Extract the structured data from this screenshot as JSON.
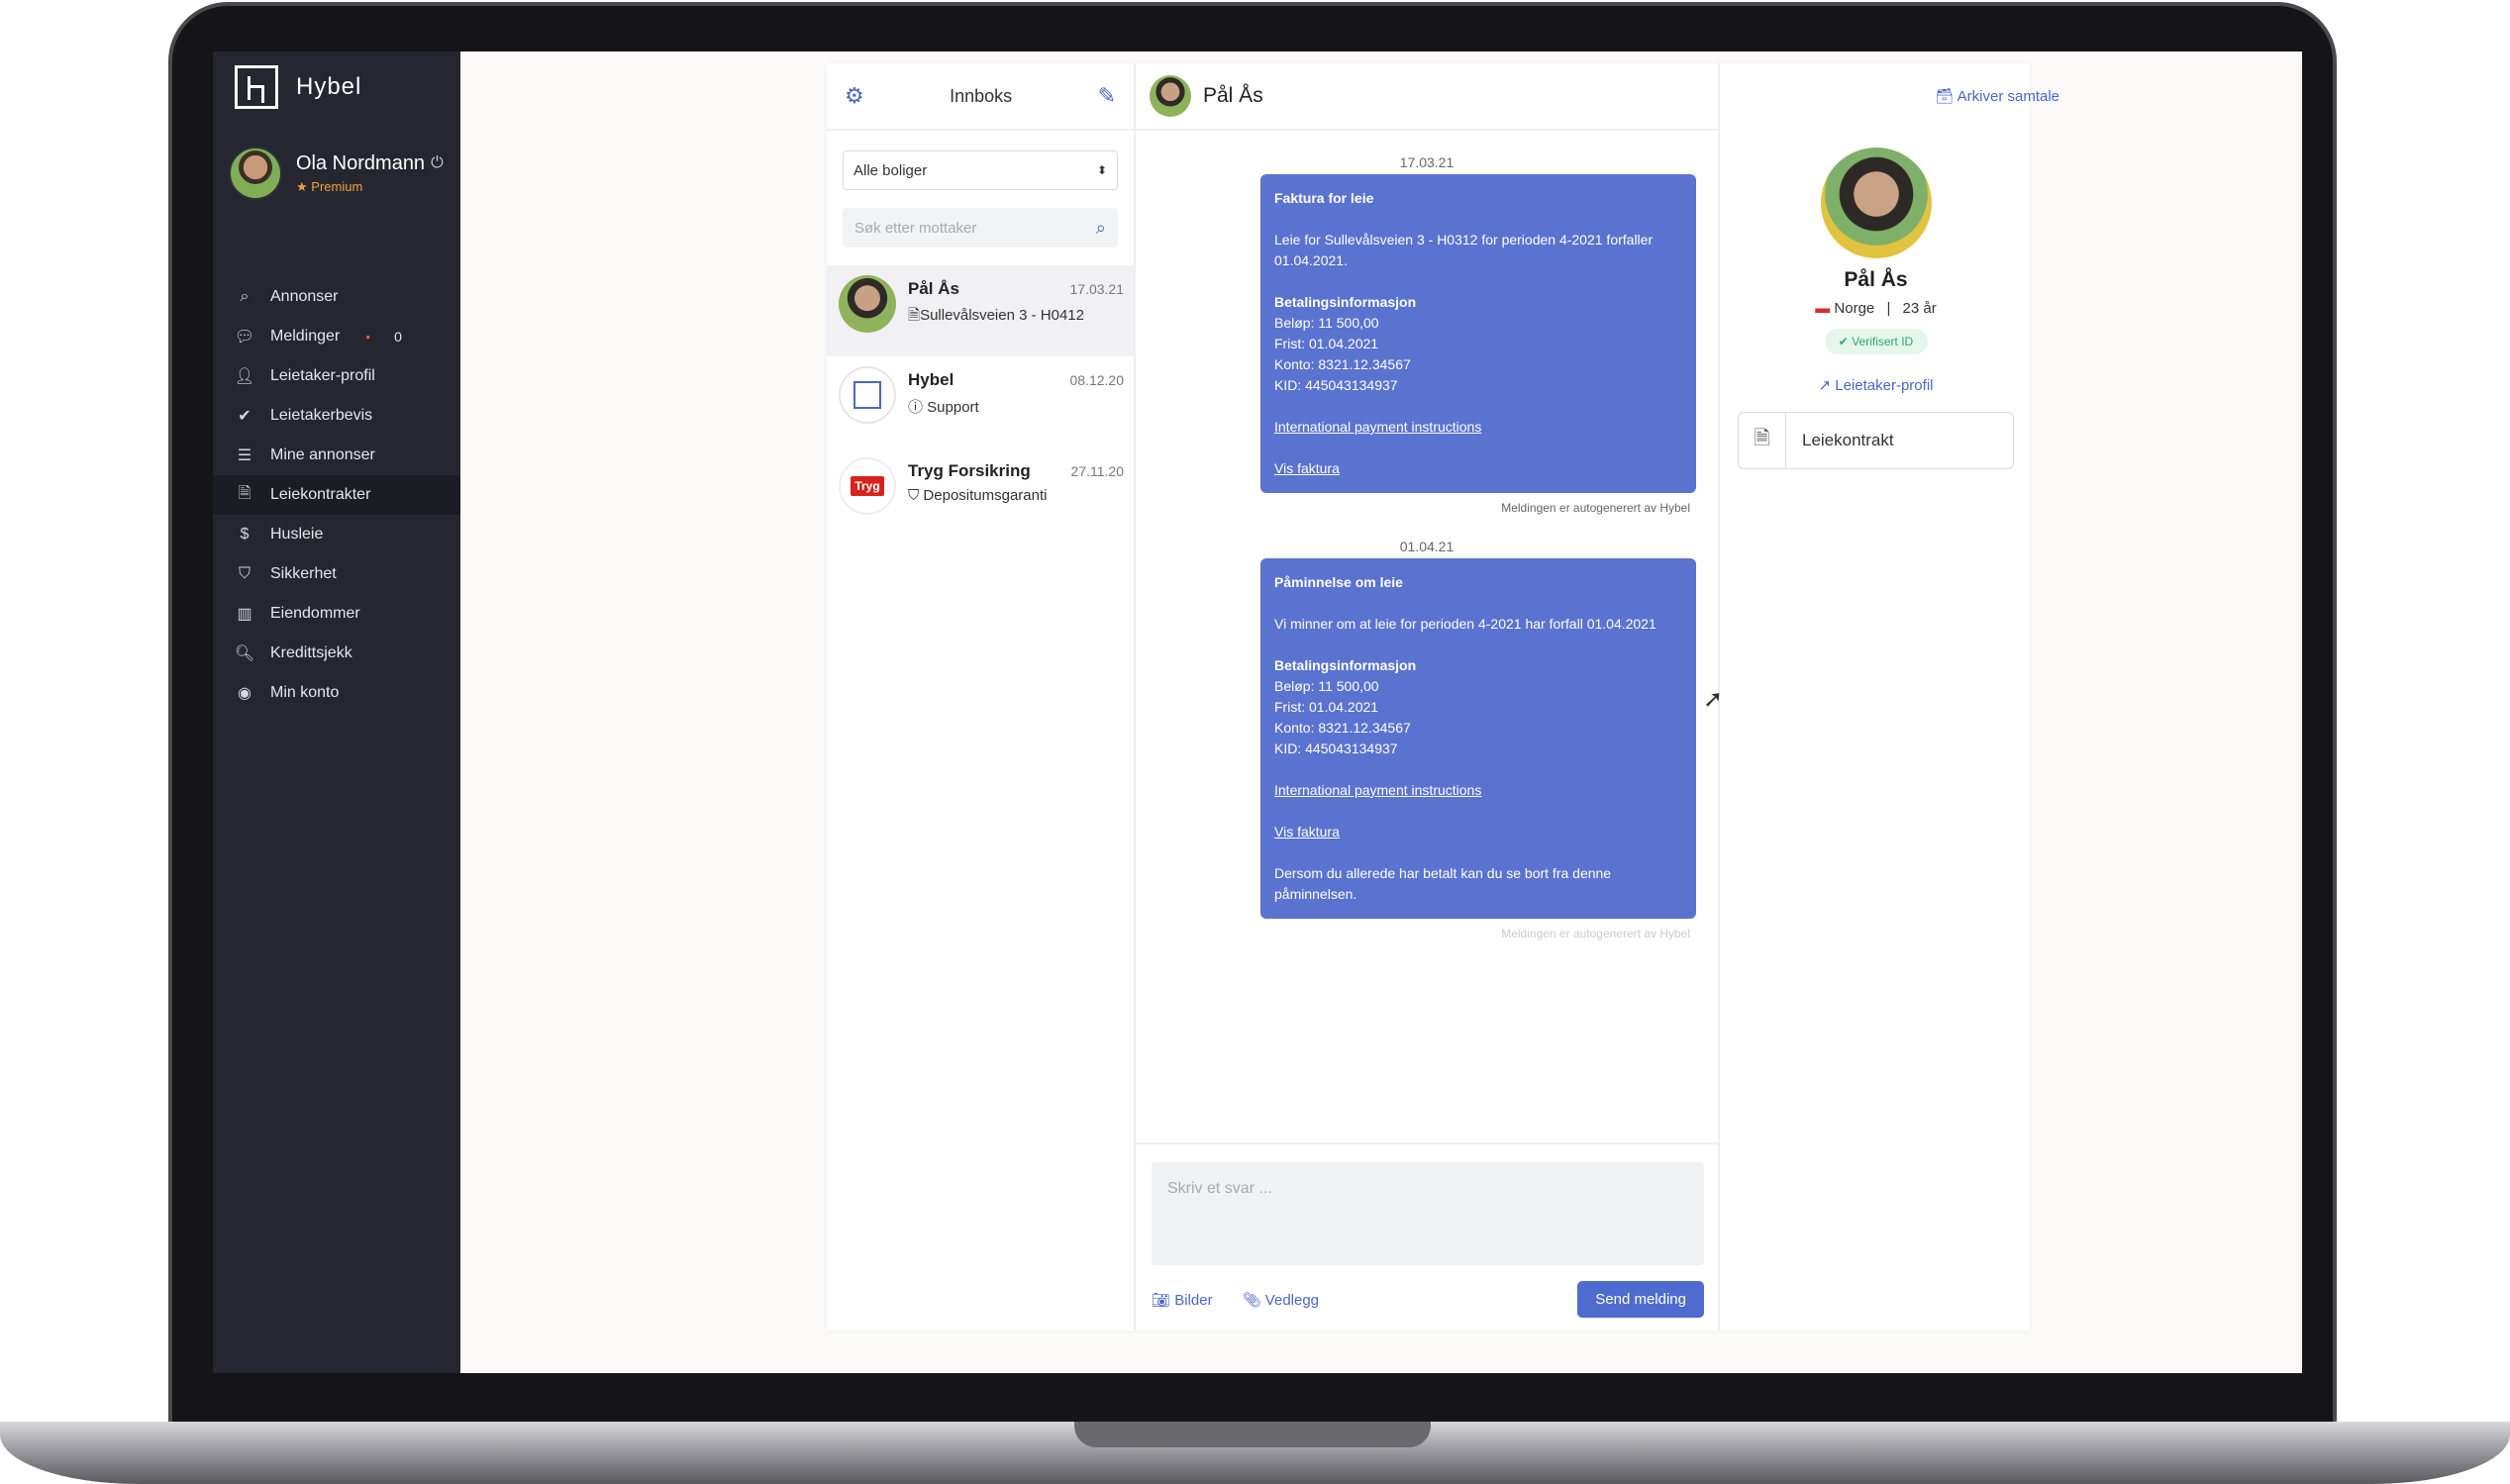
{
  "app": {
    "name": "Hybel"
  },
  "user": {
    "name": "Ola Nordmann",
    "tier": "Premium"
  },
  "nav": [
    {
      "label": "Annonser",
      "icon": "search-icon"
    },
    {
      "label": "Meldinger",
      "icon": "chat-icon",
      "count": "0"
    },
    {
      "label": "Leietaker-profil",
      "icon": "user-icon"
    },
    {
      "label": "Leietakerbevis",
      "icon": "check-circle-icon"
    },
    {
      "label": "Mine annonser",
      "icon": "list-icon"
    },
    {
      "label": "Leiekontrakter",
      "icon": "document-icon",
      "active": true
    },
    {
      "label": "Husleie",
      "icon": "dollar-icon"
    },
    {
      "label": "Sikkerhet",
      "icon": "shield-icon"
    },
    {
      "label": "Eiendommer",
      "icon": "building-icon"
    },
    {
      "label": "Kredittsjekk",
      "icon": "magnifier-icon"
    },
    {
      "label": "Min konto",
      "icon": "account-icon"
    }
  ],
  "inbox": {
    "title": "Innboks",
    "filter": "Alle boliger",
    "search_placeholder": "Søk etter mottaker",
    "conversations": [
      {
        "name": "Pål Ås",
        "subtitle": "Sullevålsveien 3 - H0412",
        "date": "17.03.21"
      },
      {
        "name": "Hybel",
        "subtitle": "Support",
        "date": "08.12.20"
      },
      {
        "name": "Tryg Forsikring",
        "subtitle": "Depositumsgaranti",
        "date": "27.11.20",
        "logo": "Tryg"
      }
    ]
  },
  "chat": {
    "contact": "Pål Ås",
    "archive_label": "Arkiver samtale",
    "messages": [
      {
        "date": "17.03.21",
        "title": "Faktura for leie",
        "body": "Leie for Sullevålsveien 3 - H0312 for perioden 4-2021 forfaller 01.04.2021.",
        "payment_heading": "Betalingsinformasjon",
        "amount": "Beløp: 11 500,00",
        "due": "Frist: 01.04.2021",
        "account": "Konto: 8321.12.34567",
        "kid": "KID: 445043134937",
        "link1": "International payment instructions",
        "link2": "Vis faktura",
        "note": "Meldingen er autogenerert av Hybel"
      },
      {
        "date": "01.04.21",
        "title": "Påminnelse om leie",
        "body": "Vi minner om at leie for perioden 4-2021 har forfall 01.04.2021",
        "payment_heading": "Betalingsinformasjon",
        "amount": "Beløp: 11 500,00",
        "due": "Frist: 01.04.2021",
        "account": "Konto: 8321.12.34567",
        "kid": "KID: 445043134937",
        "link1": "International payment instructions",
        "link2": "Vis faktura",
        "footer": "Dersom du allerede har betalt kan du se bort fra denne påminnelsen.",
        "note": "Meldingen er autogenerert av Hybel"
      }
    ],
    "reply_placeholder": "Skriv et svar ...",
    "attach_images": "Bilder",
    "attach_files": "Vedlegg",
    "send_label": "Send melding"
  },
  "profile": {
    "name": "Pål Ås",
    "country": "Norge",
    "separator": "|",
    "age": "23 år",
    "verified": "Verifisert ID",
    "profile_link": "Leietaker-profil",
    "contract": "Leiekontrakt"
  },
  "colors": {
    "accent": "#4a67c9",
    "bubble": "#5a73d0",
    "sidebar": "#25262f",
    "verified": "#2fa86a"
  }
}
